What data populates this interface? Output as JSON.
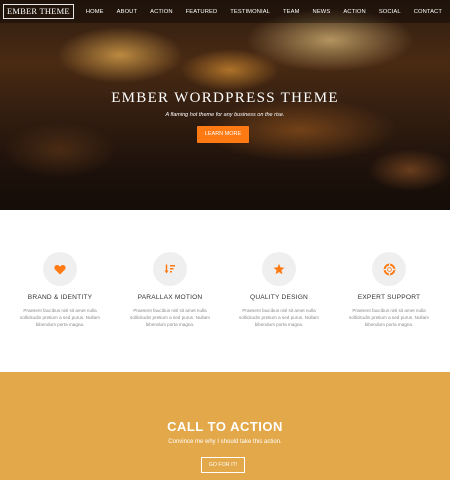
{
  "brand": "EMBER THEME",
  "nav": [
    "HOME",
    "ABOUT",
    "ACTION",
    "FEATURED",
    "TESTIMONIAL",
    "TEAM",
    "NEWS",
    "ACTION",
    "SOCIAL",
    "CONTACT"
  ],
  "hero": {
    "title": "EMBER WORDPRESS THEME",
    "subtitle": "A flaming hot theme for any business on the rise.",
    "button": "LEARN MORE"
  },
  "features": [
    {
      "icon": "heart-icon",
      "title": "BRAND & IDENTITY",
      "desc": "Praesent faucibus nisl sit amet nulla sollicitudin pretium a sed purus. Nullam bibendum porta magna."
    },
    {
      "icon": "sort-icon",
      "title": "PARALLAX MOTION",
      "desc": "Praesent faucibus nisl sit amet nulla sollicitudin pretium a sed purus. Nullam bibendum porta magna."
    },
    {
      "icon": "star-icon",
      "title": "QUALITY DESIGN",
      "desc": "Praesent faucibus nisl sit amet nulla sollicitudin pretium a sed purus. Nullam bibendum porta magna."
    },
    {
      "icon": "life-ring-icon",
      "title": "EXPERT SUPPORT",
      "desc": "Praesent faucibus nisl sit amet nulla sollicitudin pretium a sed purus. Nullam bibendum porta magna."
    }
  ],
  "cta": {
    "title": "CALL TO ACTION",
    "subtitle": "Convince me why I should take this action.",
    "button": "GO FOR IT!"
  },
  "colors": {
    "accent": "#ff7a12",
    "cta_background": "#e3a849",
    "icon_circle": "#efefef"
  }
}
